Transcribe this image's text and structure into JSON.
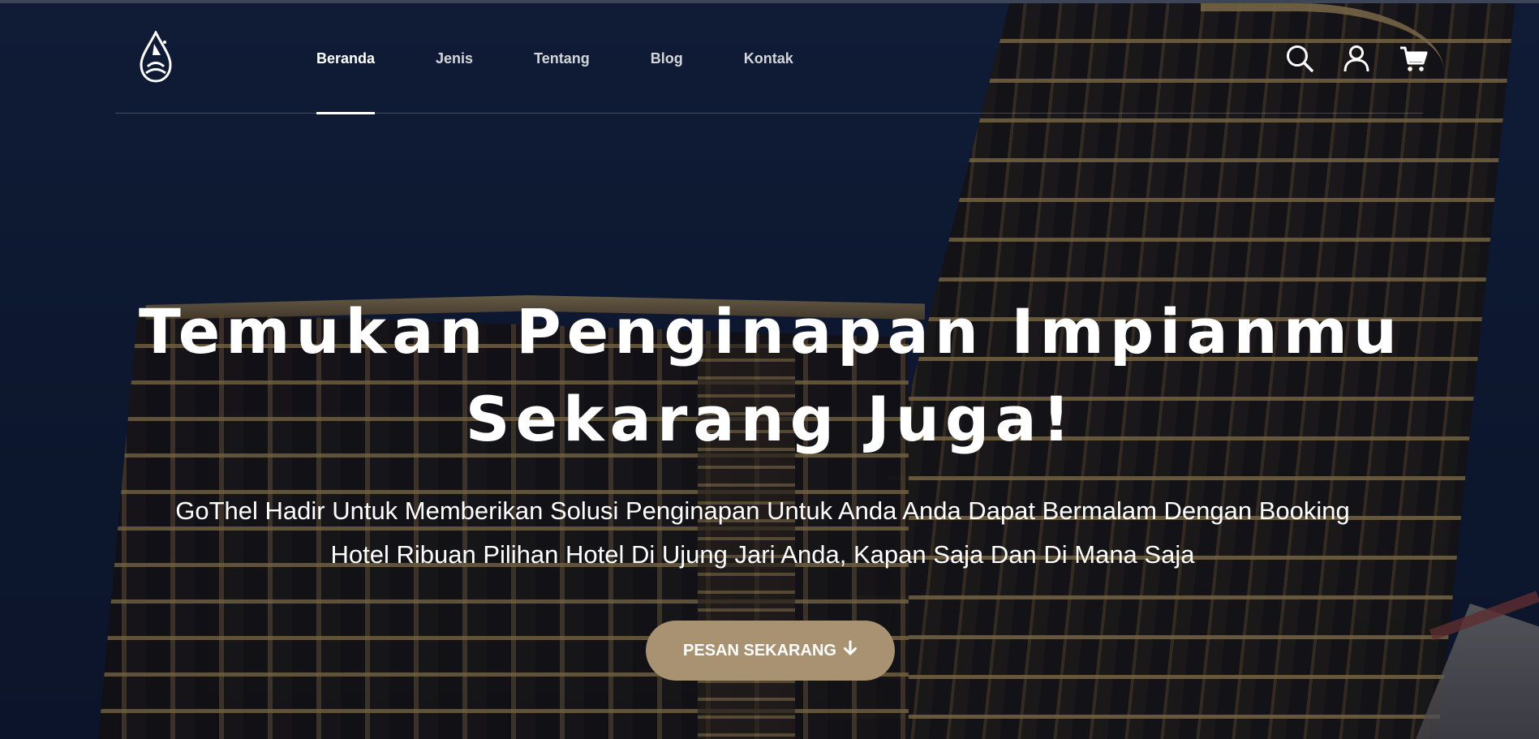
{
  "nav": {
    "logo_icon": "gothel-droplet-logo-icon",
    "items": [
      {
        "label": "Beranda",
        "active": true
      },
      {
        "label": "Jenis",
        "active": false
      },
      {
        "label": "Tentang",
        "active": false
      },
      {
        "label": "Blog",
        "active": false
      },
      {
        "label": "Kontak",
        "active": false
      }
    ],
    "icons": [
      "search-icon",
      "user-icon",
      "cart-icon"
    ]
  },
  "hero": {
    "headline_line1": "Temukan Penginapan Impianmu",
    "headline_line2": "Sekarang Juga!",
    "subtext_line1": "GoThel Hadir Untuk Memberikan Solusi Penginapan Untuk Anda Anda Dapat Bermalam Dengan Booking",
    "subtext_line2": "Hotel Ribuan Pilihan Hotel Di Ujung Jari Anda, Kapan Saja Dan Di Mana Saja",
    "cta_label": "PESAN SEKARANG",
    "cta_icon": "arrow-down-icon"
  },
  "colors": {
    "cta_background": "#a89272",
    "nav_active_underline": "#ffffff",
    "text": "#ffffff"
  }
}
